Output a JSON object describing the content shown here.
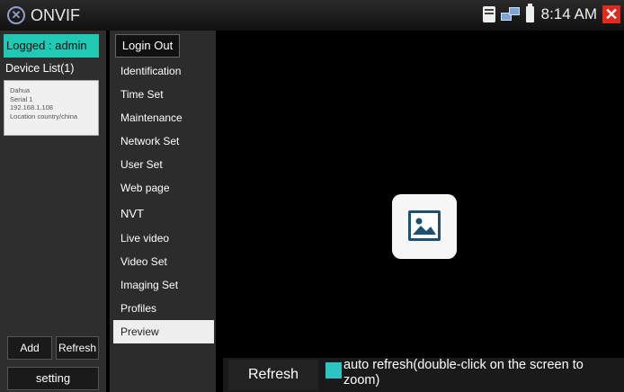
{
  "window": {
    "app_icon": "onvif-logo-icon",
    "title": "ONVIF",
    "status_icons": [
      "sd-card-icon",
      "network-icon",
      "battery-icon"
    ],
    "time": "8:14 AM",
    "close_icon": "close-icon"
  },
  "left": {
    "logged_text": "Logged : admin",
    "device_list_label": "Device List(1)",
    "device": {
      "name": "Dahua",
      "serial": "Serial 1",
      "ip": "192.168.1.108",
      "location": "Location country/china"
    },
    "add_label": "Add",
    "refresh_label": "Refresh",
    "setting_label": "setting"
  },
  "menu": {
    "logout_label": "Login Out",
    "items": [
      {
        "label": "Identification"
      },
      {
        "label": "Time Set"
      },
      {
        "label": "Maintenance"
      },
      {
        "label": "Network Set"
      },
      {
        "label": "User Set"
      },
      {
        "label": "Web page"
      }
    ],
    "section_label": "NVT",
    "nvt_items": [
      {
        "label": "Live video"
      },
      {
        "label": "Video Set"
      },
      {
        "label": "Imaging Set"
      },
      {
        "label": "Profiles"
      },
      {
        "label": "Preview"
      }
    ],
    "active": "Preview"
  },
  "preview": {
    "placeholder_icon": "image-placeholder-icon"
  },
  "bottom": {
    "refresh_label": "Refresh",
    "auto_refresh_label": "auto refresh(double-click on the screen to zoom)",
    "auto_refresh_color": "#2bc6c4"
  }
}
